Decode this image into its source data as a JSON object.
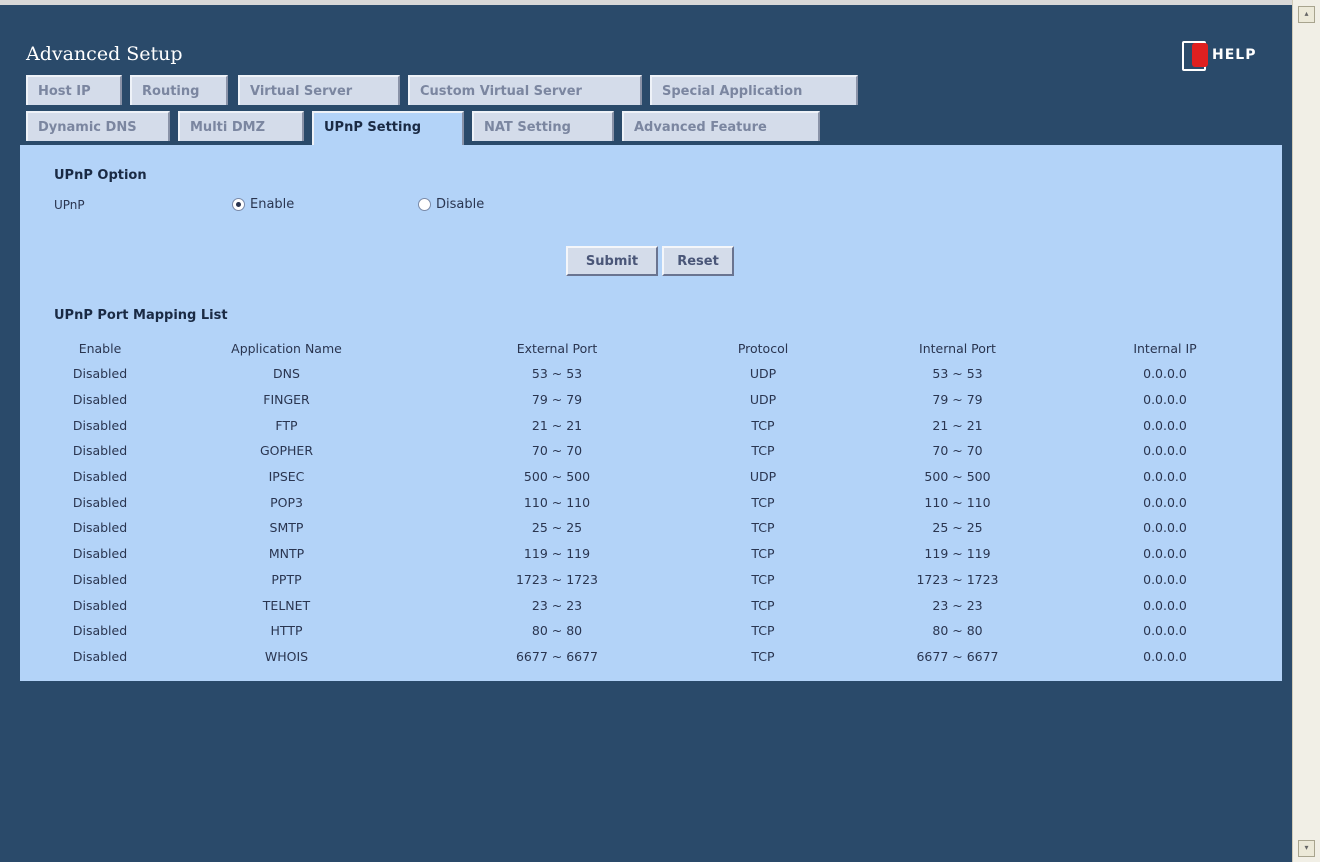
{
  "header": {
    "title": "Advanced Setup",
    "help_label": "HELP"
  },
  "tabs_row1": [
    {
      "label": "Host IP"
    },
    {
      "label": "Routing"
    },
    {
      "label": "Virtual Server"
    },
    {
      "label": "Custom Virtual Server"
    },
    {
      "label": "Special Application"
    }
  ],
  "tabs_row2": [
    {
      "label": "Dynamic DNS"
    },
    {
      "label": "Multi DMZ"
    },
    {
      "label": "UPnP Setting",
      "active": true
    },
    {
      "label": "NAT Setting"
    },
    {
      "label": "Advanced Feature"
    }
  ],
  "upnp_option": {
    "section_title": "UPnP Option",
    "field_label": "UPnP",
    "options": [
      {
        "label": "Enable",
        "selected": true
      },
      {
        "label": "Disable",
        "selected": false
      }
    ]
  },
  "buttons": {
    "submit": "Submit",
    "reset": "Reset"
  },
  "mapping_list": {
    "section_title": "UPnP Port Mapping List",
    "columns": [
      "Enable",
      "Application Name",
      "External Port",
      "Protocol",
      "Internal Port",
      "Internal IP"
    ],
    "rows": [
      [
        "Disabled",
        "DNS",
        "53 ~ 53",
        "UDP",
        "53 ~ 53",
        "0.0.0.0"
      ],
      [
        "Disabled",
        "FINGER",
        "79 ~ 79",
        "UDP",
        "79 ~ 79",
        "0.0.0.0"
      ],
      [
        "Disabled",
        "FTP",
        "21 ~ 21",
        "TCP",
        "21 ~ 21",
        "0.0.0.0"
      ],
      [
        "Disabled",
        "GOPHER",
        "70 ~ 70",
        "TCP",
        "70 ~ 70",
        "0.0.0.0"
      ],
      [
        "Disabled",
        "IPSEC",
        "500 ~ 500",
        "UDP",
        "500 ~ 500",
        "0.0.0.0"
      ],
      [
        "Disabled",
        "POP3",
        "110 ~ 110",
        "TCP",
        "110 ~ 110",
        "0.0.0.0"
      ],
      [
        "Disabled",
        "SMTP",
        "25 ~ 25",
        "TCP",
        "25 ~ 25",
        "0.0.0.0"
      ],
      [
        "Disabled",
        "MNTP",
        "119 ~ 119",
        "TCP",
        "119 ~ 119",
        "0.0.0.0"
      ],
      [
        "Disabled",
        "PPTP",
        "1723 ~ 1723",
        "TCP",
        "1723 ~ 1723",
        "0.0.0.0"
      ],
      [
        "Disabled",
        "TELNET",
        "23 ~ 23",
        "TCP",
        "23 ~ 23",
        "0.0.0.0"
      ],
      [
        "Disabled",
        "HTTP",
        "80 ~ 80",
        "TCP",
        "80 ~ 80",
        "0.0.0.0"
      ],
      [
        "Disabled",
        "WHOIS",
        "6677 ~ 6677",
        "TCP",
        "6677 ~ 6677",
        "0.0.0.0"
      ]
    ]
  },
  "colors": {
    "frame_bg": "#2a4a6a",
    "panel_bg": "#b3d3f8",
    "tab_bg": "#d4dcea",
    "help_icon": "#e02020"
  },
  "icons": [
    "help-icon",
    "radio-selected-icon",
    "radio-unselected-icon",
    "scroll-up-icon",
    "scroll-down-icon"
  ]
}
